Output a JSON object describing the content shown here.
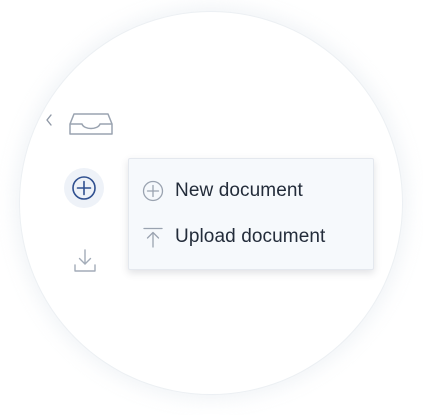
{
  "sidebar": {
    "collapse_icon": "chevron-left-icon",
    "inbox_icon": "inbox-tray-icon",
    "add_icon": "plus-circle-icon",
    "download_icon": "download-tray-icon"
  },
  "menu": {
    "items": [
      {
        "label": "New document",
        "icon": "plus-circle-icon"
      },
      {
        "label": "Upload document",
        "icon": "upload-icon"
      }
    ]
  },
  "colors": {
    "accent": "#2f4f8f",
    "icon_muted": "#9aa3b0",
    "text": "#232c3a",
    "menu_bg": "#f6f9fc"
  }
}
